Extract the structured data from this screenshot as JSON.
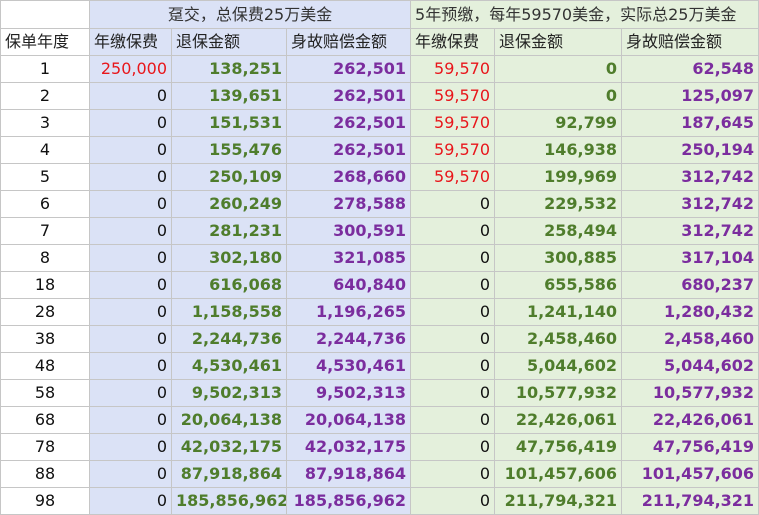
{
  "header": {
    "group_a": "趸交，总保费25万美金",
    "group_b": "5年预缴，每年59570美金，实际总25万美金",
    "year": "保单年度",
    "a_premium": "年缴保费",
    "a_surrender": "退保金额",
    "a_death": "身故赔偿金额",
    "b_premium": "年缴保费",
    "b_surrender": "退保金额",
    "b_death": "身故赔偿金额"
  },
  "rows": [
    {
      "year": "1",
      "a_premium": "250,000",
      "a_surrender": "138,251",
      "a_death": "262,501",
      "b_premium": "59,570",
      "b_surrender": "0",
      "b_death": "62,548"
    },
    {
      "year": "2",
      "a_premium": "0",
      "a_surrender": "139,651",
      "a_death": "262,501",
      "b_premium": "59,570",
      "b_surrender": "0",
      "b_death": "125,097"
    },
    {
      "year": "3",
      "a_premium": "0",
      "a_surrender": "151,531",
      "a_death": "262,501",
      "b_premium": "59,570",
      "b_surrender": "92,799",
      "b_death": "187,645"
    },
    {
      "year": "4",
      "a_premium": "0",
      "a_surrender": "155,476",
      "a_death": "262,501",
      "b_premium": "59,570",
      "b_surrender": "146,938",
      "b_death": "250,194"
    },
    {
      "year": "5",
      "a_premium": "0",
      "a_surrender": "250,109",
      "a_death": "268,660",
      "b_premium": "59,570",
      "b_surrender": "199,969",
      "b_death": "312,742"
    },
    {
      "year": "6",
      "a_premium": "0",
      "a_surrender": "260,249",
      "a_death": "278,588",
      "b_premium": "0",
      "b_surrender": "229,532",
      "b_death": "312,742"
    },
    {
      "year": "7",
      "a_premium": "0",
      "a_surrender": "281,231",
      "a_death": "300,591",
      "b_premium": "0",
      "b_surrender": "258,494",
      "b_death": "312,742"
    },
    {
      "year": "8",
      "a_premium": "0",
      "a_surrender": "302,180",
      "a_death": "321,085",
      "b_premium": "0",
      "b_surrender": "300,885",
      "b_death": "317,104"
    },
    {
      "year": "18",
      "a_premium": "0",
      "a_surrender": "616,068",
      "a_death": "640,840",
      "b_premium": "0",
      "b_surrender": "655,586",
      "b_death": "680,237"
    },
    {
      "year": "28",
      "a_premium": "0",
      "a_surrender": "1,158,558",
      "a_death": "1,196,265",
      "b_premium": "0",
      "b_surrender": "1,241,140",
      "b_death": "1,280,432"
    },
    {
      "year": "38",
      "a_premium": "0",
      "a_surrender": "2,244,736",
      "a_death": "2,244,736",
      "b_premium": "0",
      "b_surrender": "2,458,460",
      "b_death": "2,458,460"
    },
    {
      "year": "48",
      "a_premium": "0",
      "a_surrender": "4,530,461",
      "a_death": "4,530,461",
      "b_premium": "0",
      "b_surrender": "5,044,602",
      "b_death": "5,044,602"
    },
    {
      "year": "58",
      "a_premium": "0",
      "a_surrender": "9,502,313",
      "a_death": "9,502,313",
      "b_premium": "0",
      "b_surrender": "10,577,932",
      "b_death": "10,577,932"
    },
    {
      "year": "68",
      "a_premium": "0",
      "a_surrender": "20,064,138",
      "a_death": "20,064,138",
      "b_premium": "0",
      "b_surrender": "22,426,061",
      "b_death": "22,426,061"
    },
    {
      "year": "78",
      "a_premium": "0",
      "a_surrender": "42,032,175",
      "a_death": "42,032,175",
      "b_premium": "0",
      "b_surrender": "47,756,419",
      "b_death": "47,756,419"
    },
    {
      "year": "88",
      "a_premium": "0",
      "a_surrender": "87,918,864",
      "a_death": "87,918,864",
      "b_premium": "0",
      "b_surrender": "101,457,606",
      "b_death": "101,457,606"
    },
    {
      "year": "98",
      "a_premium": "0",
      "a_surrender": "185,856,962",
      "a_death": "185,856,962",
      "b_premium": "0",
      "b_surrender": "211,794,321",
      "b_death": "211,794,321"
    }
  ],
  "colors": {
    "group_a_bg": "#dbe2f6",
    "group_b_bg": "#e4f0dc",
    "premium_paid": "#e8161b",
    "surrender_value": "#4f7d2c",
    "death_benefit": "#7b2d9e",
    "grid": "#c6c6c6"
  }
}
